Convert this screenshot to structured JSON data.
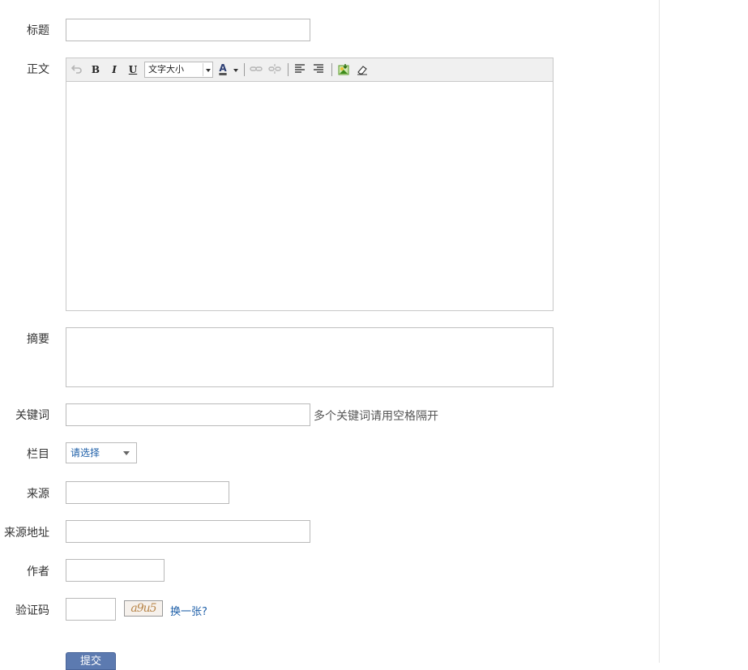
{
  "form": {
    "title_label": "标题",
    "body_label": "正文",
    "summary_label": "摘要",
    "keywords_label": "关键词",
    "keywords_hint": "多个关键词请用空格隔开",
    "category_label": "栏目",
    "category_selected": "请选择",
    "source_label": "来源",
    "source_url_label": "来源地址",
    "author_label": "作者",
    "captcha_label": "验证码",
    "captcha_image_text": "a9u5",
    "captcha_refresh": "换一张?",
    "submit_label": "提交"
  },
  "toolbar": {
    "bold": "B",
    "italic": "I",
    "underline": "U",
    "font_size_placeholder": "文字大小",
    "text_color": "A"
  },
  "colors": {
    "link": "#1e5fa8",
    "button": "#5c7ab0",
    "border": "#b9b9b9"
  },
  "icons": {
    "undo": "undo-icon",
    "link": "link-icon",
    "unlink": "unlink-icon",
    "align_left": "align-left-icon",
    "align_right": "align-right-icon",
    "insert_image": "insert-image-icon",
    "eraser": "eraser-icon"
  }
}
